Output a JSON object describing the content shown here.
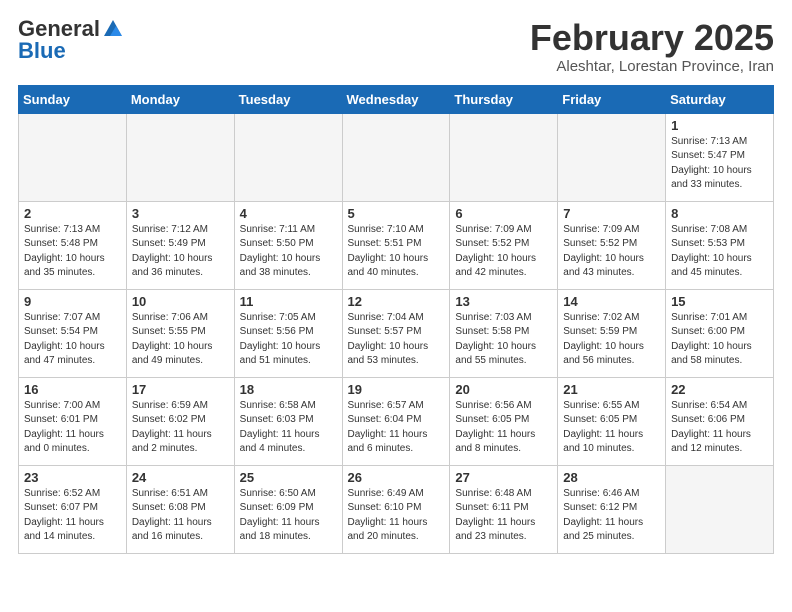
{
  "header": {
    "logo_general": "General",
    "logo_blue": "Blue",
    "month_title": "February 2025",
    "subtitle": "Aleshtar, Lorestan Province, Iran"
  },
  "days_of_week": [
    "Sunday",
    "Monday",
    "Tuesday",
    "Wednesday",
    "Thursday",
    "Friday",
    "Saturday"
  ],
  "weeks": [
    [
      {
        "num": "",
        "info": ""
      },
      {
        "num": "",
        "info": ""
      },
      {
        "num": "",
        "info": ""
      },
      {
        "num": "",
        "info": ""
      },
      {
        "num": "",
        "info": ""
      },
      {
        "num": "",
        "info": ""
      },
      {
        "num": "1",
        "info": "Sunrise: 7:13 AM\nSunset: 5:47 PM\nDaylight: 10 hours\nand 33 minutes."
      }
    ],
    [
      {
        "num": "2",
        "info": "Sunrise: 7:13 AM\nSunset: 5:48 PM\nDaylight: 10 hours\nand 35 minutes."
      },
      {
        "num": "3",
        "info": "Sunrise: 7:12 AM\nSunset: 5:49 PM\nDaylight: 10 hours\nand 36 minutes."
      },
      {
        "num": "4",
        "info": "Sunrise: 7:11 AM\nSunset: 5:50 PM\nDaylight: 10 hours\nand 38 minutes."
      },
      {
        "num": "5",
        "info": "Sunrise: 7:10 AM\nSunset: 5:51 PM\nDaylight: 10 hours\nand 40 minutes."
      },
      {
        "num": "6",
        "info": "Sunrise: 7:09 AM\nSunset: 5:52 PM\nDaylight: 10 hours\nand 42 minutes."
      },
      {
        "num": "7",
        "info": "Sunrise: 7:09 AM\nSunset: 5:52 PM\nDaylight: 10 hours\nand 43 minutes."
      },
      {
        "num": "8",
        "info": "Sunrise: 7:08 AM\nSunset: 5:53 PM\nDaylight: 10 hours\nand 45 minutes."
      }
    ],
    [
      {
        "num": "9",
        "info": "Sunrise: 7:07 AM\nSunset: 5:54 PM\nDaylight: 10 hours\nand 47 minutes."
      },
      {
        "num": "10",
        "info": "Sunrise: 7:06 AM\nSunset: 5:55 PM\nDaylight: 10 hours\nand 49 minutes."
      },
      {
        "num": "11",
        "info": "Sunrise: 7:05 AM\nSunset: 5:56 PM\nDaylight: 10 hours\nand 51 minutes."
      },
      {
        "num": "12",
        "info": "Sunrise: 7:04 AM\nSunset: 5:57 PM\nDaylight: 10 hours\nand 53 minutes."
      },
      {
        "num": "13",
        "info": "Sunrise: 7:03 AM\nSunset: 5:58 PM\nDaylight: 10 hours\nand 55 minutes."
      },
      {
        "num": "14",
        "info": "Sunrise: 7:02 AM\nSunset: 5:59 PM\nDaylight: 10 hours\nand 56 minutes."
      },
      {
        "num": "15",
        "info": "Sunrise: 7:01 AM\nSunset: 6:00 PM\nDaylight: 10 hours\nand 58 minutes."
      }
    ],
    [
      {
        "num": "16",
        "info": "Sunrise: 7:00 AM\nSunset: 6:01 PM\nDaylight: 11 hours\nand 0 minutes."
      },
      {
        "num": "17",
        "info": "Sunrise: 6:59 AM\nSunset: 6:02 PM\nDaylight: 11 hours\nand 2 minutes."
      },
      {
        "num": "18",
        "info": "Sunrise: 6:58 AM\nSunset: 6:03 PM\nDaylight: 11 hours\nand 4 minutes."
      },
      {
        "num": "19",
        "info": "Sunrise: 6:57 AM\nSunset: 6:04 PM\nDaylight: 11 hours\nand 6 minutes."
      },
      {
        "num": "20",
        "info": "Sunrise: 6:56 AM\nSunset: 6:05 PM\nDaylight: 11 hours\nand 8 minutes."
      },
      {
        "num": "21",
        "info": "Sunrise: 6:55 AM\nSunset: 6:05 PM\nDaylight: 11 hours\nand 10 minutes."
      },
      {
        "num": "22",
        "info": "Sunrise: 6:54 AM\nSunset: 6:06 PM\nDaylight: 11 hours\nand 12 minutes."
      }
    ],
    [
      {
        "num": "23",
        "info": "Sunrise: 6:52 AM\nSunset: 6:07 PM\nDaylight: 11 hours\nand 14 minutes."
      },
      {
        "num": "24",
        "info": "Sunrise: 6:51 AM\nSunset: 6:08 PM\nDaylight: 11 hours\nand 16 minutes."
      },
      {
        "num": "25",
        "info": "Sunrise: 6:50 AM\nSunset: 6:09 PM\nDaylight: 11 hours\nand 18 minutes."
      },
      {
        "num": "26",
        "info": "Sunrise: 6:49 AM\nSunset: 6:10 PM\nDaylight: 11 hours\nand 20 minutes."
      },
      {
        "num": "27",
        "info": "Sunrise: 6:48 AM\nSunset: 6:11 PM\nDaylight: 11 hours\nand 23 minutes."
      },
      {
        "num": "28",
        "info": "Sunrise: 6:46 AM\nSunset: 6:12 PM\nDaylight: 11 hours\nand 25 minutes."
      },
      {
        "num": "",
        "info": ""
      }
    ]
  ]
}
